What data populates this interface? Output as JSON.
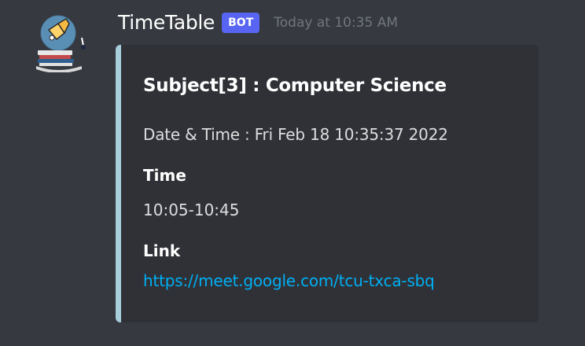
{
  "message": {
    "author": "TimeTable",
    "bot_tag": "BOT",
    "timestamp": "Today at 10:35 AM",
    "avatar_icon": "bell-calendar-avatar"
  },
  "embed": {
    "accent_color": "#a6cedb",
    "title": "Subject[3] : Computer Science",
    "description": "Date & Time : Fri Feb 18 10:35:37 2022",
    "fields": [
      {
        "name": "Time",
        "value": "10:05-10:45"
      },
      {
        "name": "Link",
        "value": "https://meet.google.com/tcu-txca-sbq"
      }
    ]
  },
  "colors": {
    "background": "#36393f",
    "embed_background": "#2f3136",
    "bot_tag": "#5865f2",
    "link": "#00aff4"
  }
}
